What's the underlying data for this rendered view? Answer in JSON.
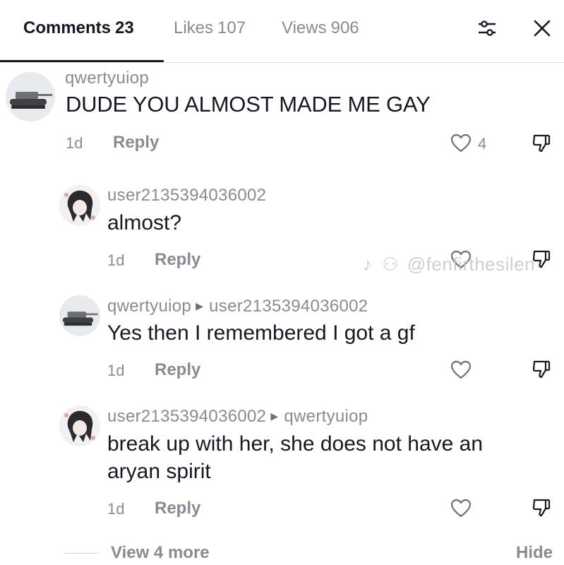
{
  "tabs": [
    {
      "label": "Comments",
      "count": "23"
    },
    {
      "label": "Likes",
      "count": "107"
    },
    {
      "label": "Views",
      "count": "906"
    }
  ],
  "header_icons": [
    "filter-sliders-icon",
    "close-icon"
  ],
  "comments": [
    {
      "username": "qwertyuiop",
      "reply_to": "",
      "text": "DUDE YOU ALMOST MADE ME GAY",
      "age": "1d",
      "reply_label": "Reply",
      "like_count": "4",
      "avatar": "tank-avatar"
    },
    {
      "username": "user2135394036002",
      "reply_to": "",
      "text": "almost?",
      "age": "1d",
      "reply_label": "Reply",
      "like_count": "",
      "avatar": "anime-avatar"
    },
    {
      "username": "qwertyuiop",
      "reply_to": "user2135394036002",
      "text": "Yes then I remembered I got a gf",
      "age": "1d",
      "reply_label": "Reply",
      "like_count": "",
      "avatar": "tank-avatar"
    },
    {
      "username": "user2135394036002",
      "reply_to": "qwertyuiop",
      "text_lines": [
        "break up with her, she does not have an",
        "aryan spirit"
      ],
      "age": "1d",
      "reply_label": "Reply",
      "like_count": "",
      "avatar": "anime-avatar"
    }
  ],
  "watermark": "@fenfirthesilen",
  "footer": {
    "view_more": "View 4 more",
    "hide": "Hide"
  },
  "colors": {
    "text": "#161823",
    "muted": "#8a8b91",
    "divider": "#e3e3e4"
  }
}
